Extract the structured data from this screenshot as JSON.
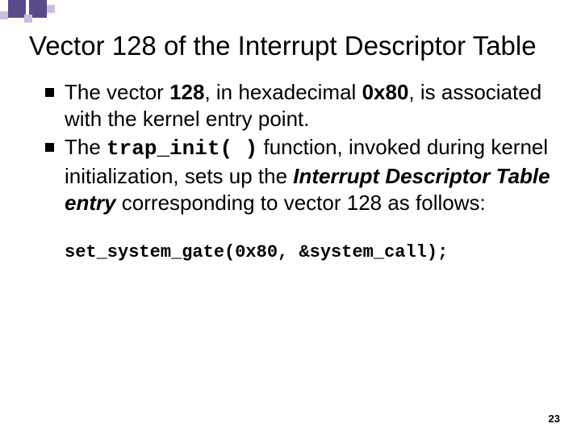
{
  "decoration": {
    "name": "corner-squares"
  },
  "title": "Vector 128 of the Interrupt Descriptor Table",
  "bullets": [
    {
      "pre": "The vector ",
      "b1": "128",
      "mid1": ", in hexadecimal ",
      "b2": "0x80",
      "post": ", is associated with the kernel entry point."
    },
    {
      "pre": "The ",
      "code": "trap_init( )",
      "mid1": " function, invoked during kernel initialization, sets up the ",
      "ital": "Interrupt Descriptor Table entry",
      "post": " corresponding to vector 128 as follows:"
    }
  ],
  "code_line": "set_system_gate(0x80, &system_call);",
  "page_number": "23"
}
